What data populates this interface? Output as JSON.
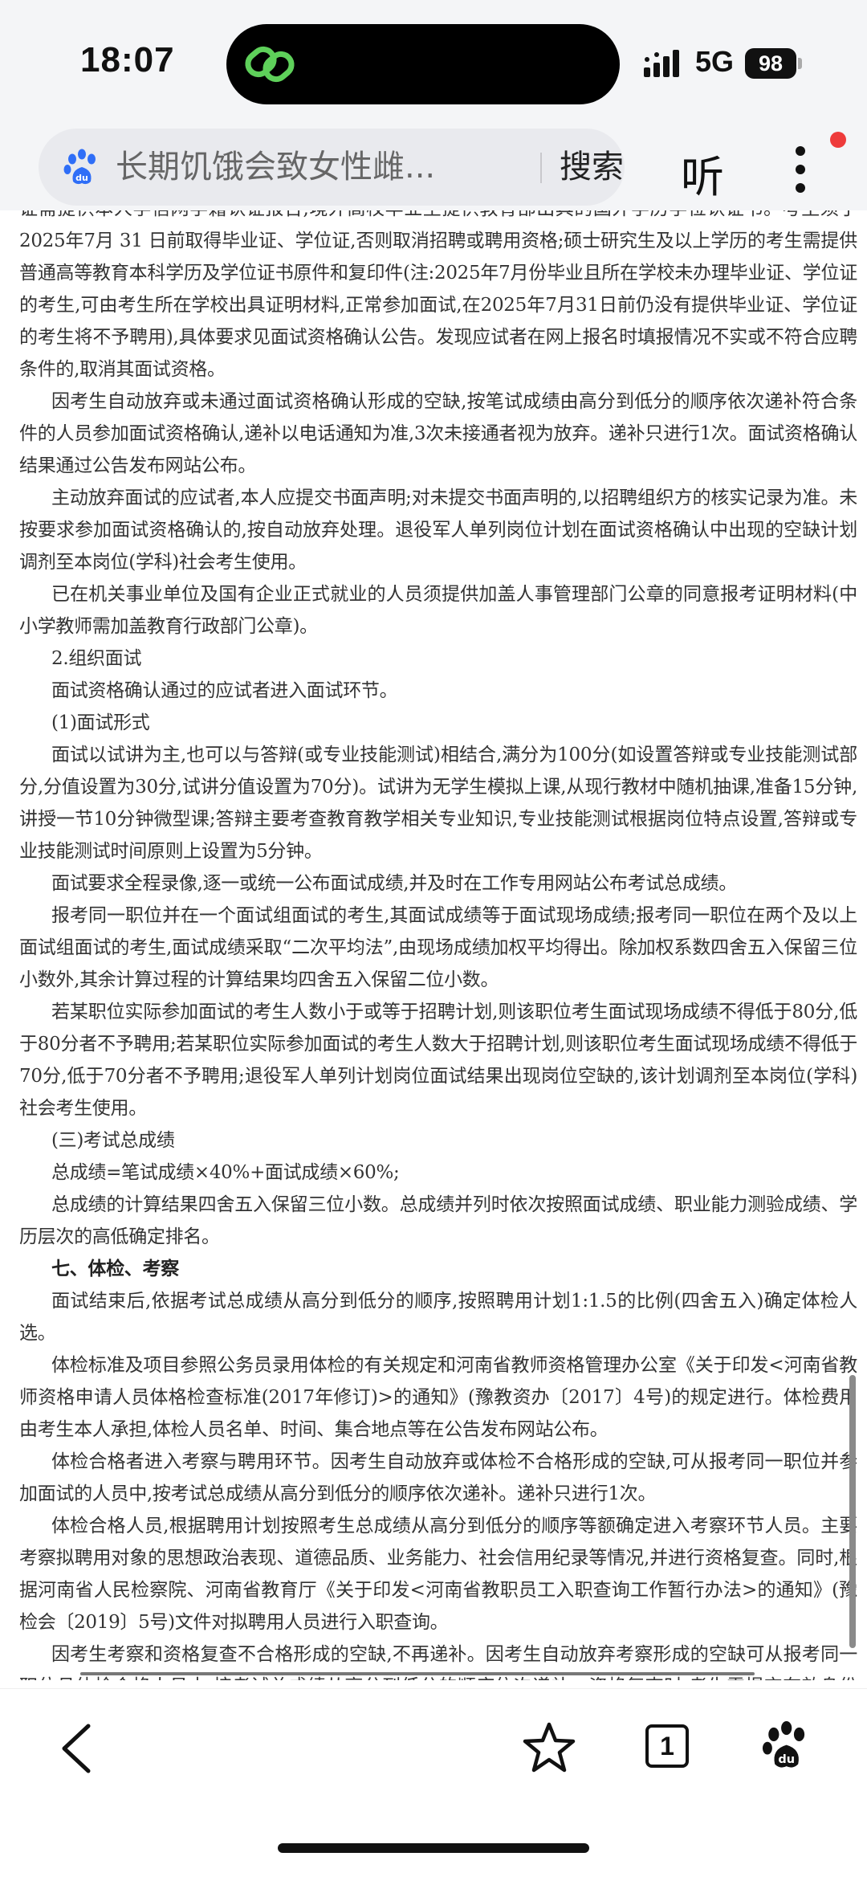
{
  "status": {
    "time": "18:07",
    "network": "5G",
    "battery": "98"
  },
  "search": {
    "query": "长期饥饿会致女性雌...",
    "button": "搜索"
  },
  "toolbar": {
    "listen": "听",
    "tab_count": "1"
  },
  "article": {
    "paragraphs": [
      {
        "style": "plain",
        "text": "证需提供本人学信网学籍认证报告,境外高校毕业生提供教育部出具的国外学历学位认证书。考生须于2025年7月 31 日前取得毕业证、学位证,否则取消招聘或聘用资格;硕士研究生及以上学历的考生需提供普通高等教育本科学历及学位证书原件和复印件(注:2025年7月份毕业且所在学校未办理毕业证、学位证的考生,可由考生所在学校出具证明材料,正常参加面试,在2025年7月31日前仍没有提供毕业证、学位证的考生将不予聘用),具体要求见面试资格确认公告。发现应试者在网上报名时填报情况不实或不符合应聘条件的,取消其面试资格。"
      },
      {
        "style": "indent",
        "text": "因考生自动放弃或未通过面试资格确认形成的空缺,按笔试成绩由高分到低分的顺序依次递补符合条件的人员参加面试资格确认,递补以电话通知为准,3次未接通者视为放弃。递补只进行1次。面试资格确认结果通过公告发布网站公布。"
      },
      {
        "style": "indent",
        "text": "主动放弃面试的应试者,本人应提交书面声明;对未提交书面声明的,以招聘组织方的核实记录为准。未按要求参加面试资格确认的,按自动放弃处理。退役军人单列岗位计划在面试资格确认中出现的空缺计划调剂至本岗位(学科)社会考生使用。"
      },
      {
        "style": "indent",
        "text": "已在机关事业单位及国有企业正式就业的人员须提供加盖人事管理部门公章的同意报考证明材料(中小学教师需加盖教育行政部门公章)。"
      },
      {
        "style": "indent",
        "text": "2.组织面试"
      },
      {
        "style": "indent",
        "text": "面试资格确认通过的应试者进入面试环节。"
      },
      {
        "style": "indent",
        "text": "(1)面试形式"
      },
      {
        "style": "indent",
        "text": "面试以试讲为主,也可以与答辩(或专业技能测试)相结合,满分为100分(如设置答辩或专业技能测试部分,分值设置为30分,试讲分值设置为70分)。试讲为无学生模拟上课,从现行教材中随机抽课,准备15分钟,讲授一节10分钟微型课;答辩主要考查教育教学相关专业知识,专业技能测试根据岗位特点设置,答辩或专业技能测试时间原则上设置为5分钟。"
      },
      {
        "style": "indent",
        "text": "面试要求全程录像,逐一或统一公布面试成绩,并及时在工作专用网站公布考试总成绩。"
      },
      {
        "style": "indent",
        "text": "报考同一职位并在一个面试组面试的考生,其面试成绩等于面试现场成绩;报考同一职位在两个及以上面试组面试的考生,面试成绩采取“二次平均法”,由现场成绩加权平均得出。除加权系数四舍五入保留三位小数外,其余计算过程的计算结果均四舍五入保留二位小数。"
      },
      {
        "style": "indent",
        "text": "若某职位实际参加面试的考生人数小于或等于招聘计划,则该职位考生面试现场成绩不得低于80分,低于80分者不予聘用;若某职位实际参加面试的考生人数大于招聘计划,则该职位考生面试现场成绩不得低于70分,低于70分者不予聘用;退役军人单列计划岗位面试结果出现岗位空缺的,该计划调剂至本岗位(学科)社会考生使用。"
      },
      {
        "style": "indent",
        "text": "(三)考试总成绩"
      },
      {
        "style": "indent",
        "text": "总成绩=笔试成绩×40%+面试成绩×60%;"
      },
      {
        "style": "indent",
        "text": "总成绩的计算结果四舍五入保留三位小数。总成绩并列时依次按照面试成绩、职业能力测验成绩、学历层次的高低确定排名。"
      },
      {
        "style": "heading",
        "text": "七、体检、考察"
      },
      {
        "style": "indent",
        "text": "面试结束后,依据考试总成绩从高分到低分的顺序,按照聘用计划1:1.5的比例(四舍五入)确定体检人选。"
      },
      {
        "style": "indent",
        "text": "体检标准及项目参照公务员录用体检的有关规定和河南省教师资格管理办公室《关于印发<河南省教师资格申请人员体格检查标准(2017年修订)>的通知》(豫教资办〔2017〕4号)的规定进行。体检费用由考生本人承担,体检人员名单、时间、集合地点等在公告发布网站公布。"
      },
      {
        "style": "indent",
        "text": "体检合格者进入考察与聘用环节。因考生自动放弃或体检不合格形成的空缺,可从报考同一职位并参加面试的人员中,按考试总成绩从高分到低分的顺序依次递补。递补只进行1次。"
      },
      {
        "style": "indent",
        "text": "体检合格人员,根据聘用计划按照考生总成绩从高分到低分的顺序等额确定进入考察环节人员。主要考察拟聘用对象的思想政治表现、道德品质、业务能力、社会信用纪录等情况,并进行资格复查。同时,根据河南省人民检察院、河南省教育厅《关于印发<河南省教职员工入职查询工作暂行办法>的通知》(豫检会〔2019〕5号)文件对拟聘用人员进行入职查询。"
      },
      {
        "style": "indent",
        "text": "因考生考察和资格复查不合格形成的空缺,不再递补。因考生自动放弃考察形成的空缺可从报考同一职位且体检合格人员中,按考试总成绩从高分到低分的顺序依次递补。资格复查时,考生需提交有效身份证、毕业证、学位证等材料原件及复印件。"
      }
    ]
  },
  "colors": {
    "background": "#f4f5f7",
    "search_box": "#e9eaee",
    "notification_dot": "#ee3b3b"
  }
}
